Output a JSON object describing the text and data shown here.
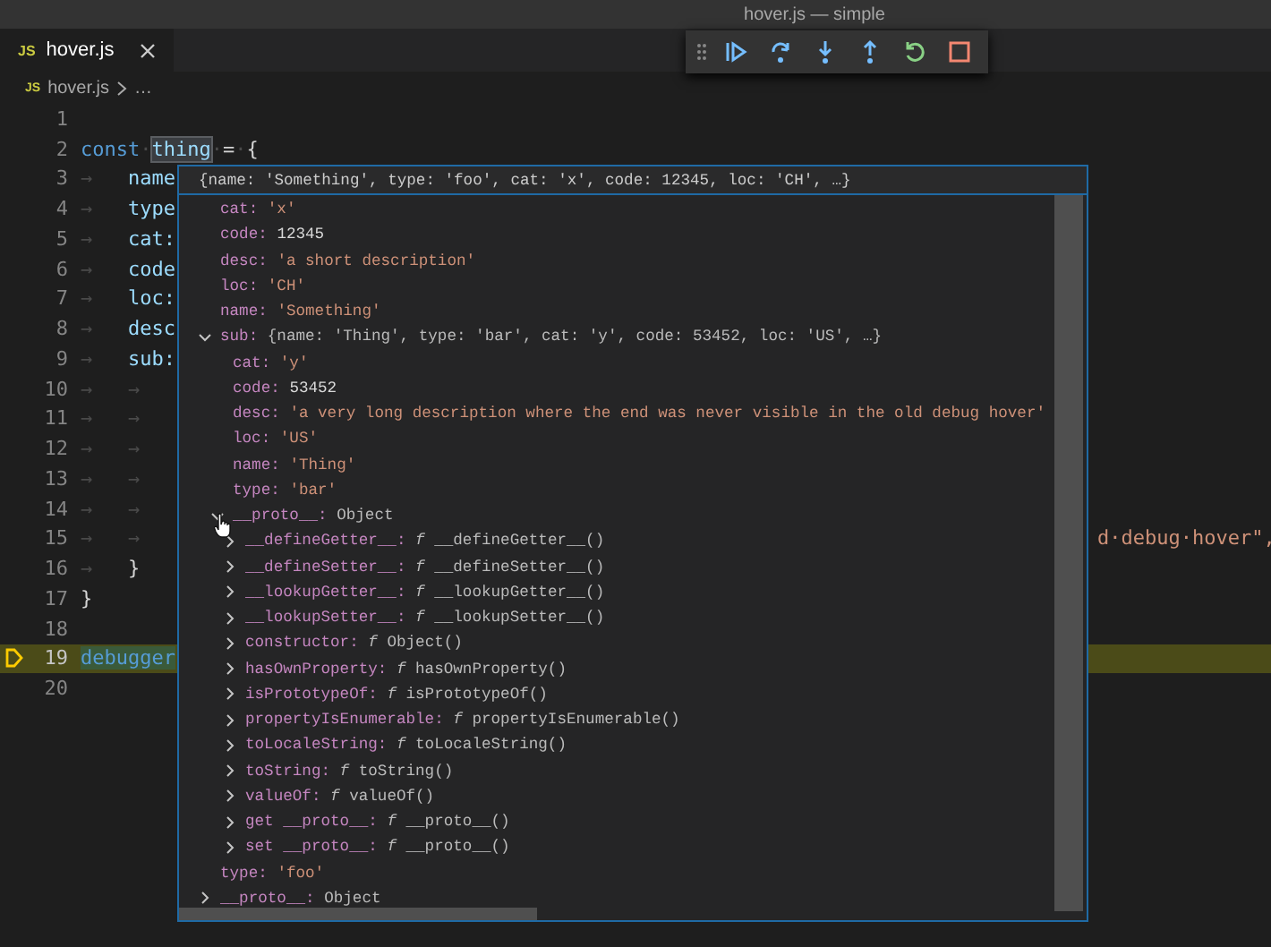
{
  "window": {
    "title": "hover.js — simple"
  },
  "tabs": [
    {
      "badge": "JS",
      "label": "hover.js",
      "selected": true
    }
  ],
  "breadcrumb": {
    "badge": "JS",
    "items": [
      "hover.js",
      "…"
    ]
  },
  "editor": {
    "lines": [
      {
        "number": "1",
        "current": false
      },
      {
        "number": "2",
        "current": false,
        "tokens": [
          {
            "kind": "keyword",
            "text": "const"
          },
          {
            "kind": "whitespace",
            "text": "·"
          },
          {
            "kind": "variable",
            "text": "thing",
            "highlighted": true
          },
          {
            "kind": "whitespace",
            "text": "·"
          },
          {
            "kind": "plain",
            "text": "="
          },
          {
            "kind": "whitespace",
            "text": "·"
          },
          {
            "kind": "plain",
            "text": "{"
          }
        ]
      },
      {
        "number": "3",
        "current": false,
        "tokens": [
          {
            "kind": "whitespace",
            "text": "→   "
          },
          {
            "kind": "property",
            "text": "name"
          }
        ]
      },
      {
        "number": "4",
        "current": false,
        "tokens": [
          {
            "kind": "whitespace",
            "text": "→   "
          },
          {
            "kind": "property",
            "text": "type"
          }
        ]
      },
      {
        "number": "5",
        "current": false,
        "tokens": [
          {
            "kind": "whitespace",
            "text": "→   "
          },
          {
            "kind": "property",
            "text": "cat:"
          }
        ]
      },
      {
        "number": "6",
        "current": false,
        "tokens": [
          {
            "kind": "whitespace",
            "text": "→   "
          },
          {
            "kind": "property",
            "text": "code"
          }
        ]
      },
      {
        "number": "7",
        "current": false,
        "tokens": [
          {
            "kind": "whitespace",
            "text": "→   "
          },
          {
            "kind": "property",
            "text": "loc:"
          }
        ]
      },
      {
        "number": "8",
        "current": false,
        "tokens": [
          {
            "kind": "whitespace",
            "text": "→   "
          },
          {
            "kind": "property",
            "text": "desc"
          }
        ]
      },
      {
        "number": "9",
        "current": false,
        "tokens": [
          {
            "kind": "whitespace",
            "text": "→   "
          },
          {
            "kind": "property",
            "text": "sub:"
          }
        ]
      },
      {
        "number": "10",
        "current": false,
        "tokens": [
          {
            "kind": "whitespace",
            "text": "→   →"
          }
        ]
      },
      {
        "number": "11",
        "current": false,
        "tokens": [
          {
            "kind": "whitespace",
            "text": "→   →"
          }
        ]
      },
      {
        "number": "12",
        "current": false,
        "tokens": [
          {
            "kind": "whitespace",
            "text": "→   →"
          }
        ]
      },
      {
        "number": "13",
        "current": false,
        "tokens": [
          {
            "kind": "whitespace",
            "text": "→   →"
          }
        ]
      },
      {
        "number": "14",
        "current": false,
        "tokens": [
          {
            "kind": "whitespace",
            "text": "→   →"
          }
        ]
      },
      {
        "number": "15",
        "current": false,
        "tokens": [
          {
            "kind": "whitespace",
            "text": "→   →"
          }
        ],
        "tail": "d·debug·hover\","
      },
      {
        "number": "16",
        "current": false,
        "tokens": [
          {
            "kind": "whitespace",
            "text": "→   "
          },
          {
            "kind": "plain",
            "text": "}"
          }
        ]
      },
      {
        "number": "17",
        "current": false,
        "tokens": [
          {
            "kind": "plain",
            "text": "}"
          }
        ]
      },
      {
        "number": "18",
        "current": false
      },
      {
        "number": "19",
        "current": true,
        "tokens": [
          {
            "kind": "keyword",
            "text": "debugger",
            "highlighted": true
          }
        ]
      },
      {
        "number": "20",
        "current": false
      }
    ]
  },
  "hover": {
    "summary": "{name: 'Something', type: 'foo', cat: 'x', code: 12345, loc: 'CH', …}",
    "items": [
      {
        "key": "cat:",
        "value": "'x'",
        "kind": "string"
      },
      {
        "key": "code:",
        "value": "12345",
        "kind": "number"
      },
      {
        "key": "desc:",
        "value": "'a short description'",
        "kind": "string"
      },
      {
        "key": "loc:",
        "value": "'CH'",
        "kind": "string"
      },
      {
        "key": "name:",
        "value": "'Something'",
        "kind": "string"
      },
      {
        "key": "sub:",
        "value": "{name: 'Thing', type: 'bar', cat: 'y', code: 53452, loc: 'US', …}",
        "kind": "object",
        "expanded": true,
        "children": [
          {
            "key": "cat:",
            "value": "'y'",
            "kind": "string"
          },
          {
            "key": "code:",
            "value": "53452",
            "kind": "number"
          },
          {
            "key": "desc:",
            "value": "'a very long description where the end was never visible in the old debug hover'",
            "kind": "string"
          },
          {
            "key": "loc:",
            "value": "'US'",
            "kind": "string"
          },
          {
            "key": "name:",
            "value": "'Thing'",
            "kind": "string"
          },
          {
            "key": "type:",
            "value": "'bar'",
            "kind": "string"
          },
          {
            "key": "__proto__:",
            "value": "Object",
            "kind": "object",
            "expanded": true,
            "children": [
              {
                "key": "__defineGetter__:",
                "value": "*f* __defineGetter__()",
                "kind": "function",
                "expanded": false
              },
              {
                "key": "__defineSetter__:",
                "value": "*f* __defineSetter__()",
                "kind": "function",
                "expanded": false
              },
              {
                "key": "__lookupGetter__:",
                "value": "*f* __lookupGetter__()",
                "kind": "function",
                "expanded": false
              },
              {
                "key": "__lookupSetter__:",
                "value": "*f* __lookupSetter__()",
                "kind": "function",
                "expanded": false
              },
              {
                "key": "constructor:",
                "value": "*f* Object()",
                "kind": "function",
                "expanded": false
              },
              {
                "key": "hasOwnProperty:",
                "value": "*f* hasOwnProperty()",
                "kind": "function",
                "expanded": false
              },
              {
                "key": "isPrototypeOf:",
                "value": "*f* isPrototypeOf()",
                "kind": "function",
                "expanded": false
              },
              {
                "key": "propertyIsEnumerable:",
                "value": "*f* propertyIsEnumerable()",
                "kind": "function",
                "expanded": false
              },
              {
                "key": "toLocaleString:",
                "value": "*f* toLocaleString()",
                "kind": "function",
                "expanded": false
              },
              {
                "key": "toString:",
                "value": "*f* toString()",
                "kind": "function",
                "expanded": false
              },
              {
                "key": "valueOf:",
                "value": "*f* valueOf()",
                "kind": "function",
                "expanded": false
              },
              {
                "key": "get __proto__:",
                "value": "*f* __proto__()",
                "kind": "function",
                "expanded": false
              },
              {
                "key": "set __proto__:",
                "value": "*f* __proto__()",
                "kind": "function",
                "expanded": false
              }
            ]
          }
        ]
      },
      {
        "key": "type:",
        "value": "'foo'",
        "kind": "string"
      },
      {
        "key": "__proto__:",
        "value": "Object",
        "kind": "object",
        "expanded": false
      }
    ]
  }
}
